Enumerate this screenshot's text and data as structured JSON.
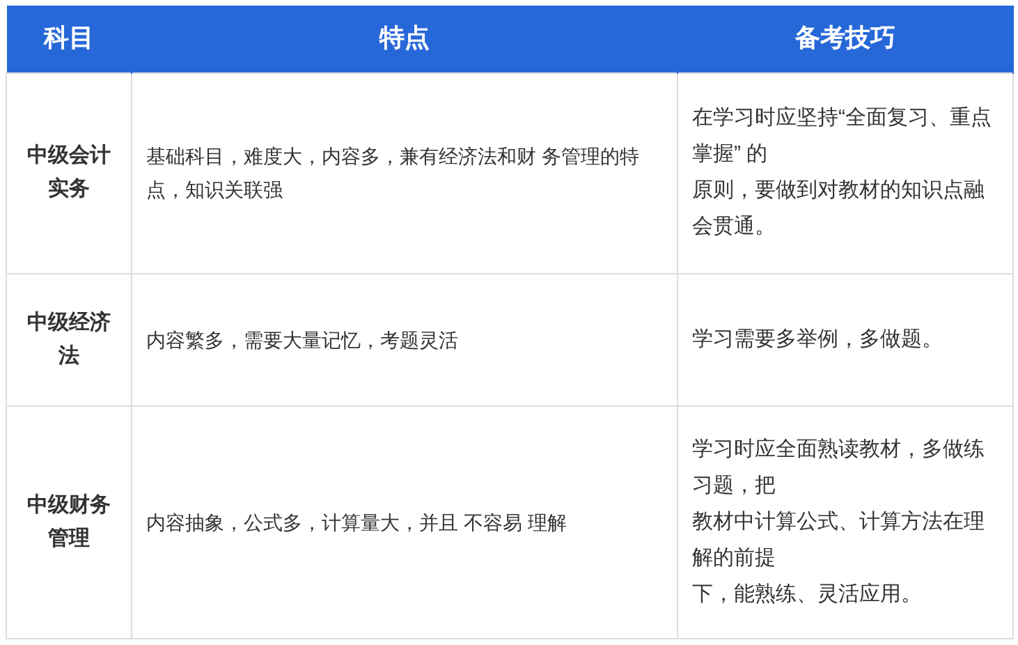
{
  "table": {
    "columns": [
      "科目",
      "特点",
      "备考技巧"
    ],
    "rows": [
      {
        "subject": "中级会计实务",
        "features": "基础科目，难度大，内容多，兼有经济法和财 务管理的特点，知识关联强",
        "tips": [
          "在学习时应坚持“全面复习、重点掌握” 的",
          "原则，要做到对教材的知识点融会贯通。"
        ]
      },
      {
        "subject": "中级经济法",
        "features": "内容繁多，需要大量记忆，考题灵活",
        "tips": [
          "学习需要多举例，多做题。"
        ]
      },
      {
        "subject": "中级财务管理",
        "features": "内容抽象，公式多，计算量大，并且 不容易 理解",
        "tips": [
          "学习时应全面熟读教材，多做练习题，把",
          "教材中计算公式、计算方法在理解的前提",
          "下，能熟练、灵活应用。"
        ]
      }
    ]
  }
}
